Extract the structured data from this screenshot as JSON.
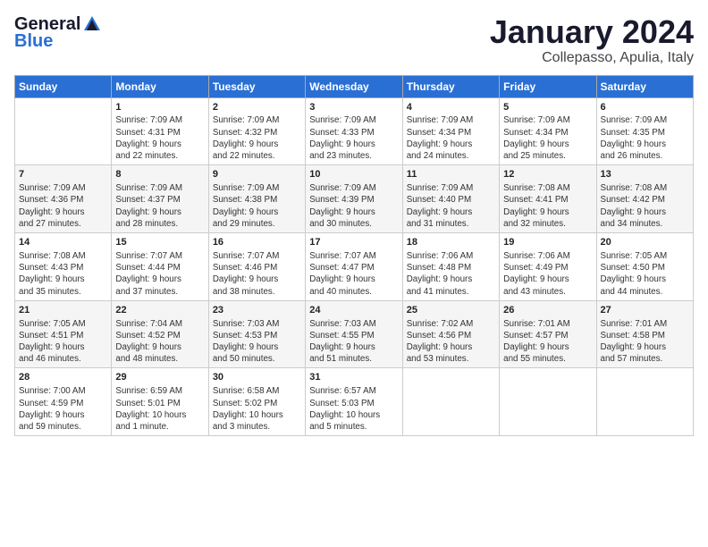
{
  "header": {
    "logo_general": "General",
    "logo_blue": "Blue",
    "title": "January 2024",
    "subtitle": "Collepasso, Apulia, Italy"
  },
  "days_of_week": [
    "Sunday",
    "Monday",
    "Tuesday",
    "Wednesday",
    "Thursday",
    "Friday",
    "Saturday"
  ],
  "weeks": [
    [
      {
        "day": "",
        "info": ""
      },
      {
        "day": "1",
        "info": "Sunrise: 7:09 AM\nSunset: 4:31 PM\nDaylight: 9 hours\nand 22 minutes."
      },
      {
        "day": "2",
        "info": "Sunrise: 7:09 AM\nSunset: 4:32 PM\nDaylight: 9 hours\nand 22 minutes."
      },
      {
        "day": "3",
        "info": "Sunrise: 7:09 AM\nSunset: 4:33 PM\nDaylight: 9 hours\nand 23 minutes."
      },
      {
        "day": "4",
        "info": "Sunrise: 7:09 AM\nSunset: 4:34 PM\nDaylight: 9 hours\nand 24 minutes."
      },
      {
        "day": "5",
        "info": "Sunrise: 7:09 AM\nSunset: 4:34 PM\nDaylight: 9 hours\nand 25 minutes."
      },
      {
        "day": "6",
        "info": "Sunrise: 7:09 AM\nSunset: 4:35 PM\nDaylight: 9 hours\nand 26 minutes."
      }
    ],
    [
      {
        "day": "7",
        "info": "Sunrise: 7:09 AM\nSunset: 4:36 PM\nDaylight: 9 hours\nand 27 minutes."
      },
      {
        "day": "8",
        "info": "Sunrise: 7:09 AM\nSunset: 4:37 PM\nDaylight: 9 hours\nand 28 minutes."
      },
      {
        "day": "9",
        "info": "Sunrise: 7:09 AM\nSunset: 4:38 PM\nDaylight: 9 hours\nand 29 minutes."
      },
      {
        "day": "10",
        "info": "Sunrise: 7:09 AM\nSunset: 4:39 PM\nDaylight: 9 hours\nand 30 minutes."
      },
      {
        "day": "11",
        "info": "Sunrise: 7:09 AM\nSunset: 4:40 PM\nDaylight: 9 hours\nand 31 minutes."
      },
      {
        "day": "12",
        "info": "Sunrise: 7:08 AM\nSunset: 4:41 PM\nDaylight: 9 hours\nand 32 minutes."
      },
      {
        "day": "13",
        "info": "Sunrise: 7:08 AM\nSunset: 4:42 PM\nDaylight: 9 hours\nand 34 minutes."
      }
    ],
    [
      {
        "day": "14",
        "info": "Sunrise: 7:08 AM\nSunset: 4:43 PM\nDaylight: 9 hours\nand 35 minutes."
      },
      {
        "day": "15",
        "info": "Sunrise: 7:07 AM\nSunset: 4:44 PM\nDaylight: 9 hours\nand 37 minutes."
      },
      {
        "day": "16",
        "info": "Sunrise: 7:07 AM\nSunset: 4:46 PM\nDaylight: 9 hours\nand 38 minutes."
      },
      {
        "day": "17",
        "info": "Sunrise: 7:07 AM\nSunset: 4:47 PM\nDaylight: 9 hours\nand 40 minutes."
      },
      {
        "day": "18",
        "info": "Sunrise: 7:06 AM\nSunset: 4:48 PM\nDaylight: 9 hours\nand 41 minutes."
      },
      {
        "day": "19",
        "info": "Sunrise: 7:06 AM\nSunset: 4:49 PM\nDaylight: 9 hours\nand 43 minutes."
      },
      {
        "day": "20",
        "info": "Sunrise: 7:05 AM\nSunset: 4:50 PM\nDaylight: 9 hours\nand 44 minutes."
      }
    ],
    [
      {
        "day": "21",
        "info": "Sunrise: 7:05 AM\nSunset: 4:51 PM\nDaylight: 9 hours\nand 46 minutes."
      },
      {
        "day": "22",
        "info": "Sunrise: 7:04 AM\nSunset: 4:52 PM\nDaylight: 9 hours\nand 48 minutes."
      },
      {
        "day": "23",
        "info": "Sunrise: 7:03 AM\nSunset: 4:53 PM\nDaylight: 9 hours\nand 50 minutes."
      },
      {
        "day": "24",
        "info": "Sunrise: 7:03 AM\nSunset: 4:55 PM\nDaylight: 9 hours\nand 51 minutes."
      },
      {
        "day": "25",
        "info": "Sunrise: 7:02 AM\nSunset: 4:56 PM\nDaylight: 9 hours\nand 53 minutes."
      },
      {
        "day": "26",
        "info": "Sunrise: 7:01 AM\nSunset: 4:57 PM\nDaylight: 9 hours\nand 55 minutes."
      },
      {
        "day": "27",
        "info": "Sunrise: 7:01 AM\nSunset: 4:58 PM\nDaylight: 9 hours\nand 57 minutes."
      }
    ],
    [
      {
        "day": "28",
        "info": "Sunrise: 7:00 AM\nSunset: 4:59 PM\nDaylight: 9 hours\nand 59 minutes."
      },
      {
        "day": "29",
        "info": "Sunrise: 6:59 AM\nSunset: 5:01 PM\nDaylight: 10 hours\nand 1 minute."
      },
      {
        "day": "30",
        "info": "Sunrise: 6:58 AM\nSunset: 5:02 PM\nDaylight: 10 hours\nand 3 minutes."
      },
      {
        "day": "31",
        "info": "Sunrise: 6:57 AM\nSunset: 5:03 PM\nDaylight: 10 hours\nand 5 minutes."
      },
      {
        "day": "",
        "info": ""
      },
      {
        "day": "",
        "info": ""
      },
      {
        "day": "",
        "info": ""
      }
    ]
  ]
}
